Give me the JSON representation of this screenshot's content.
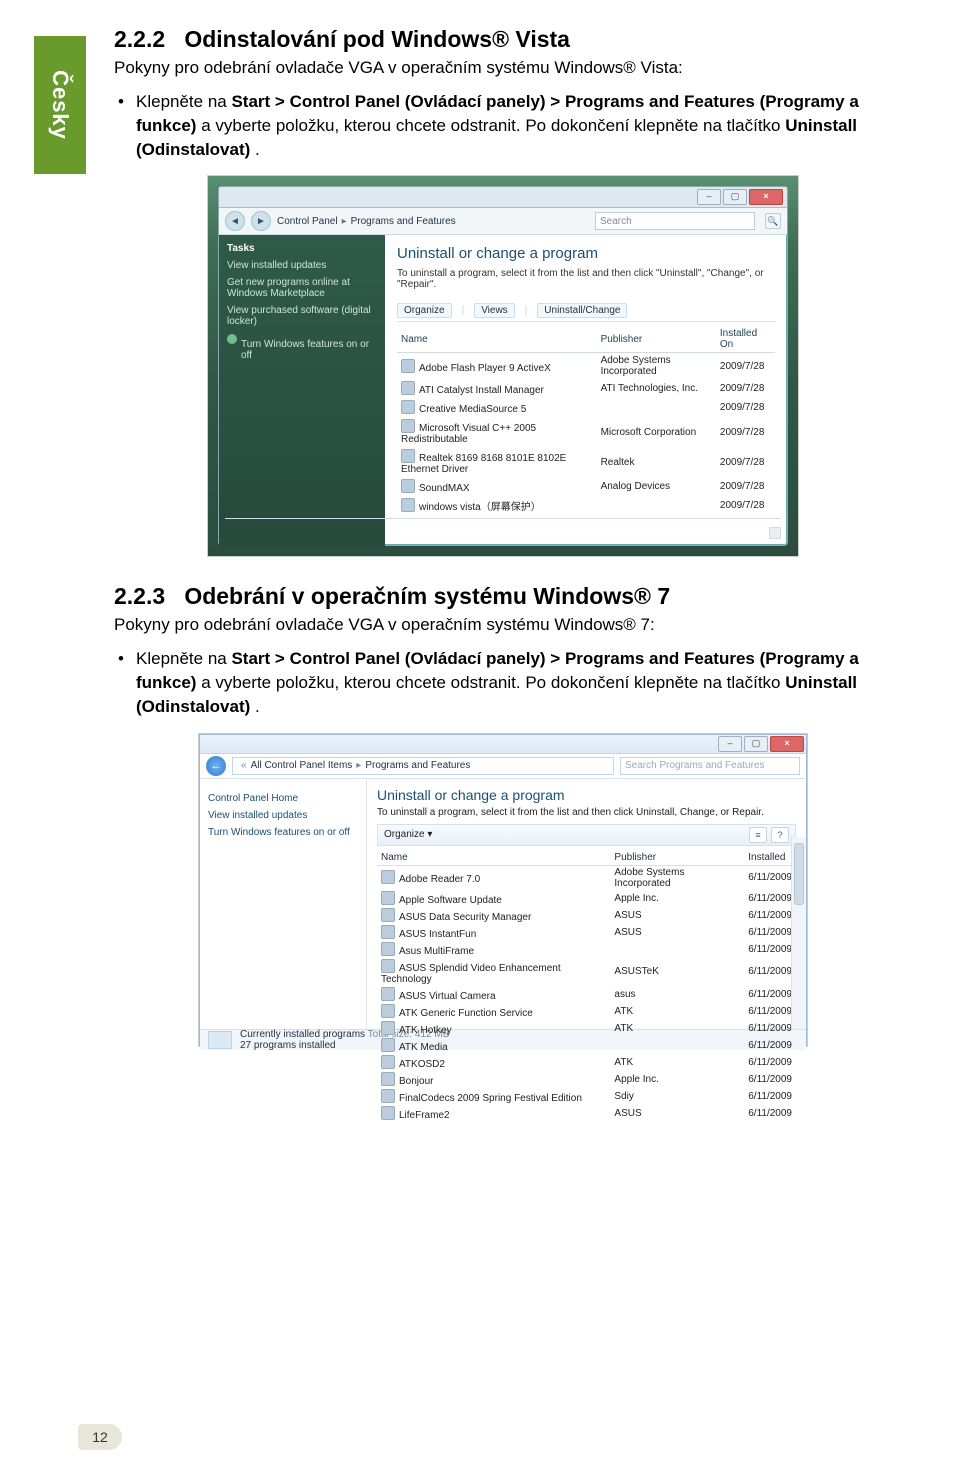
{
  "sideTab": "Česky",
  "pageNumber": "12",
  "s1": {
    "num": "2.2.2",
    "title": "Odinstalování pod Windows® Vista",
    "lead": "Pokyny pro odebrání ovladače VGA v operačním systému Windows® Vista:",
    "bullet": {
      "p1": "Klepněte na ",
      "b1": "Start > Control Panel (Ovládací panely) > Programs and Features (Programy a funkce)",
      "p2": " a vyberte položku, kterou chcete odstranit. Po dokončení klepněte na tlačítko ",
      "b2": "Uninstall (Odinstalovat)",
      "p3": ".",
      "b3": "",
      "p4": ""
    }
  },
  "s2": {
    "num": "2.2.3",
    "title": "Odebrání v operačním systému  Windows® 7",
    "lead": "Pokyny pro odebrání ovladače VGA v operačním systému Windows® 7:",
    "bullet": {
      "p1": "Klepněte na ",
      "b1": "Start > Control Panel (Ovládací panely) > Programs and Features (Programy a funkce)",
      "p2": " a vyberte položku, kterou chcete odstranit. Po dokončení klepněte na tlačítko ",
      "b2": "Uninstall (Odinstalovat)",
      "p3": ".",
      "b3": "",
      "p4": ""
    }
  },
  "vista": {
    "crumb1": "Control Panel",
    "crumb2": "Programs and Features",
    "search": "Search",
    "tasksHd": "Tasks",
    "side": [
      "View installed updates",
      "Get new programs online at Windows Marketplace",
      "View purchased software (digital locker)",
      "Turn Windows features on or off"
    ],
    "mainHd": "Uninstall or change a program",
    "mainSub": "To uninstall a program, select it from the list and then click \"Uninstall\", \"Change\", or \"Repair\".",
    "tool": [
      "Organize",
      "Views",
      "Uninstall/Change"
    ],
    "cols": [
      "Name",
      "Publisher",
      "Installed On"
    ],
    "rows": [
      [
        "Adobe Flash Player 9 ActiveX",
        "Adobe Systems Incorporated",
        "2009/7/28"
      ],
      [
        "ATI Catalyst Install Manager",
        "ATI Technologies, Inc.",
        "2009/7/28"
      ],
      [
        "Creative MediaSource 5",
        "",
        "2009/7/28"
      ],
      [
        "Microsoft Visual C++ 2005 Redistributable",
        "Microsoft Corporation",
        "2009/7/28"
      ],
      [
        "Realtek 8169 8168 8101E 8102E Ethernet Driver",
        "Realtek",
        "2009/7/28"
      ],
      [
        "SoundMAX",
        "Analog Devices",
        "2009/7/28"
      ],
      [
        "windows vista（屏幕保护）",
        "",
        "2009/7/28"
      ]
    ]
  },
  "win7": {
    "crumb0": "",
    "crumb1": "All Control Panel Items",
    "crumb2": "Programs and Features",
    "search": "Search Programs and Features",
    "side": [
      "Control Panel Home",
      "View installed updates",
      "Turn Windows features on or off"
    ],
    "mainHd": "Uninstall or change a program",
    "mainSub": "To uninstall a program, select it from the list and then click Uninstall, Change, or Repair.",
    "tool": "Organize ▾",
    "cols": [
      "Name",
      "Publisher",
      "Installed"
    ],
    "rows": [
      [
        "Adobe Reader 7.0",
        "Adobe Systems Incorporated",
        "6/11/2009"
      ],
      [
        "Apple Software Update",
        "Apple Inc.",
        "6/11/2009"
      ],
      [
        "ASUS Data Security Manager",
        "ASUS",
        "6/11/2009"
      ],
      [
        "ASUS InstantFun",
        "ASUS",
        "6/11/2009"
      ],
      [
        "Asus MultiFrame",
        "",
        "6/11/2009"
      ],
      [
        "ASUS Splendid Video Enhancement Technology",
        "ASUSTeK",
        "6/11/2009"
      ],
      [
        "ASUS Virtual Camera",
        "asus",
        "6/11/2009"
      ],
      [
        "ATK Generic Function Service",
        "ATK",
        "6/11/2009"
      ],
      [
        "ATK Hotkey",
        "ATK",
        "6/11/2009"
      ],
      [
        "ATK Media",
        "",
        "6/11/2009"
      ],
      [
        "ATKOSD2",
        "ATK",
        "6/11/2009"
      ],
      [
        "Bonjour",
        "Apple Inc.",
        "6/11/2009"
      ],
      [
        "FinalCodecs 2009 Spring Festival Edition",
        "Sdiy",
        "6/11/2009"
      ],
      [
        "LifeFrame2",
        "ASUS",
        "6/11/2009"
      ]
    ],
    "status": {
      "l1a": "Currently installed programs",
      "l1b": "Total size: 412 MB",
      "l2": "27 programs installed"
    }
  }
}
